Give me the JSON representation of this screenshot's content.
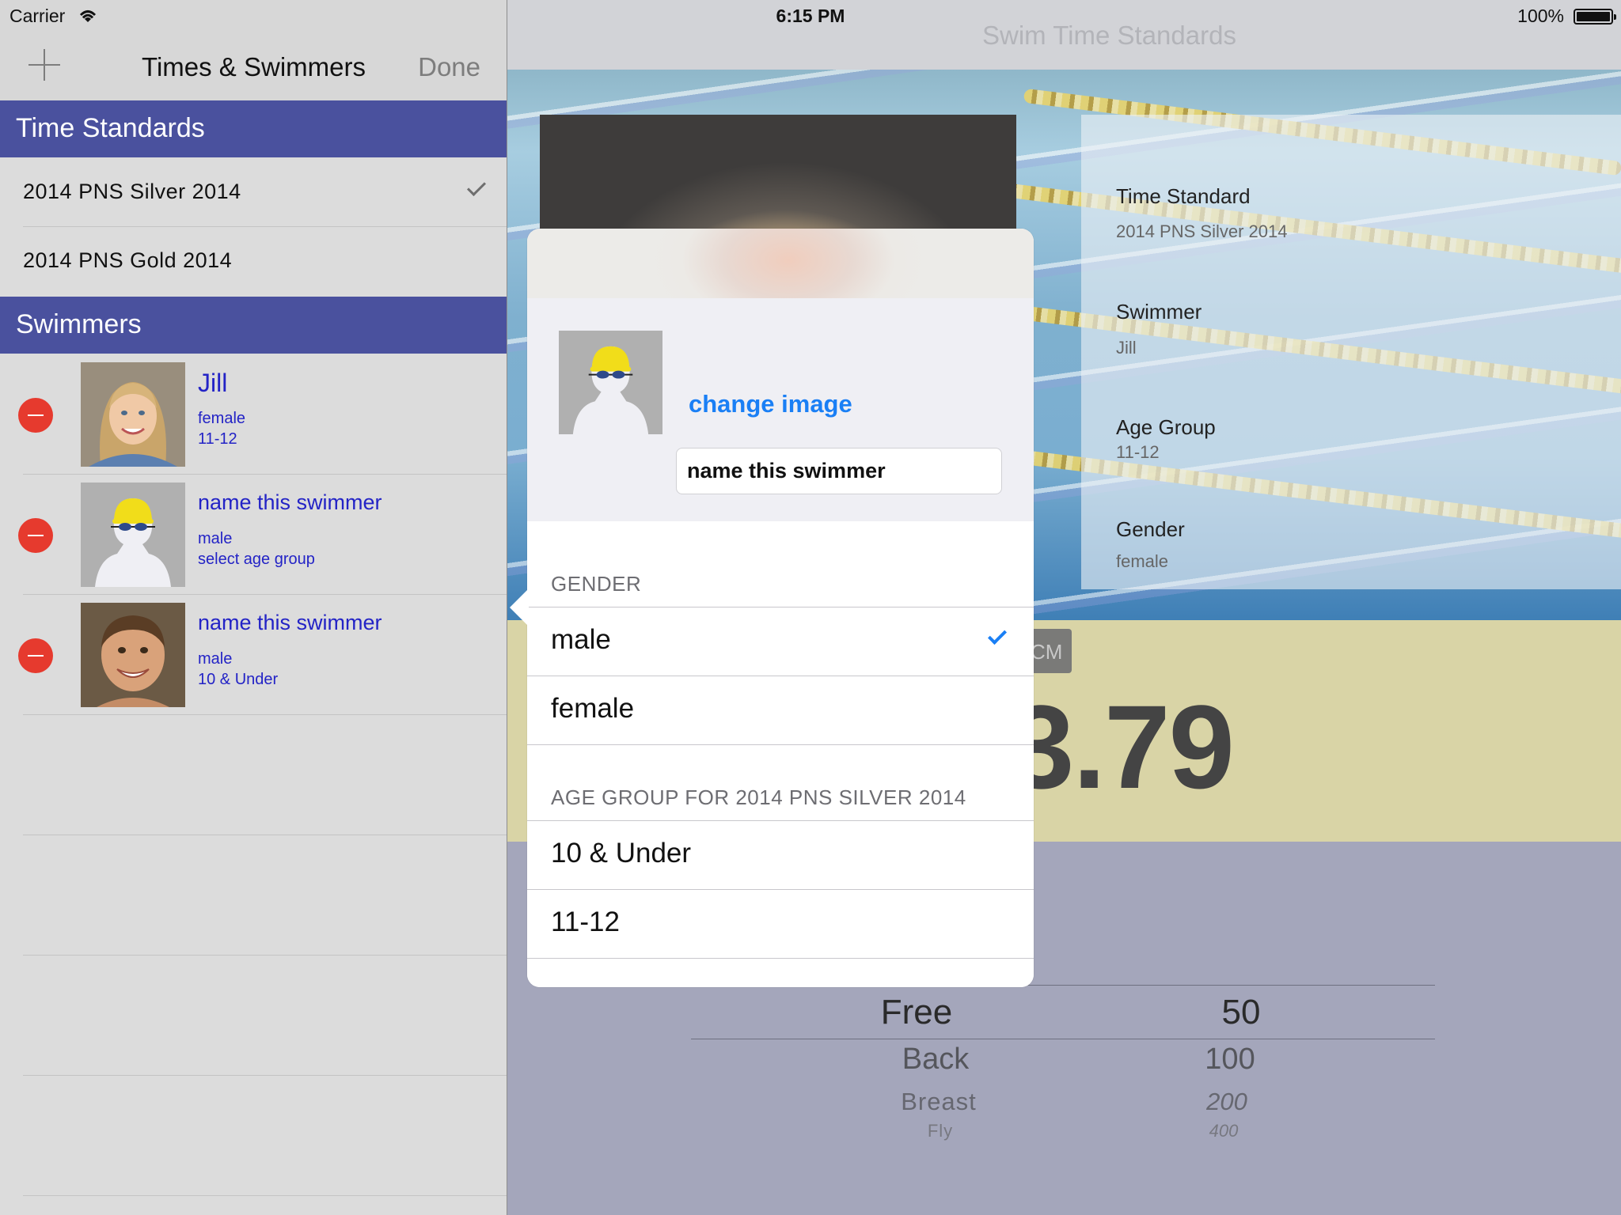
{
  "status_bar": {
    "carrier": "Carrier",
    "time": "6:15 PM",
    "battery": "100%"
  },
  "master": {
    "title": "Times & Swimmers",
    "done_label": "Done",
    "standards_header": "Time Standards",
    "standards": [
      {
        "label": "2014 PNS Silver 2014",
        "selected": true
      },
      {
        "label": "2014 PNS Gold 2014",
        "selected": false
      }
    ],
    "swimmers_header": "Swimmers",
    "swimmers": [
      {
        "name": "Jill",
        "gender": "female",
        "age_group": "11-12"
      },
      {
        "name": "name this swimmer",
        "gender": "male",
        "age_group": "select age group"
      },
      {
        "name": "name this swimmer",
        "gender": "male",
        "age_group": "10 & Under"
      }
    ]
  },
  "detail": {
    "title": "Swim Time Standards",
    "info": {
      "time_standard_label": "Time Standard",
      "time_standard_value": "2014 PNS Silver 2014",
      "swimmer_label": "Swimmer",
      "swimmer_value": "Jill",
      "age_group_label": "Age Group",
      "age_group_value": "11-12",
      "gender_label": "Gender",
      "gender_value": "female"
    },
    "course_badge": "CM",
    "time_display": "3.79",
    "picker": {
      "strokes": [
        "Free",
        "Back",
        "Breast",
        "Fly"
      ],
      "distances": [
        "50",
        "100",
        "200",
        "400"
      ]
    }
  },
  "popover": {
    "change_image_label": "change image",
    "name_value": "name this swimmer",
    "gender_header": "GENDER",
    "genders": [
      {
        "label": "male",
        "selected": true
      },
      {
        "label": "female",
        "selected": false
      }
    ],
    "age_group_header": "AGE GROUP FOR 2014 PNS SILVER 2014",
    "age_groups": [
      "10 & Under",
      "11-12"
    ]
  },
  "colors": {
    "section_header": "#4a519e",
    "link_blue": "#2323c6",
    "ios_blue": "#1a7ff5",
    "delete_red": "#e63a2e",
    "time_band": "#d9d4a6"
  }
}
